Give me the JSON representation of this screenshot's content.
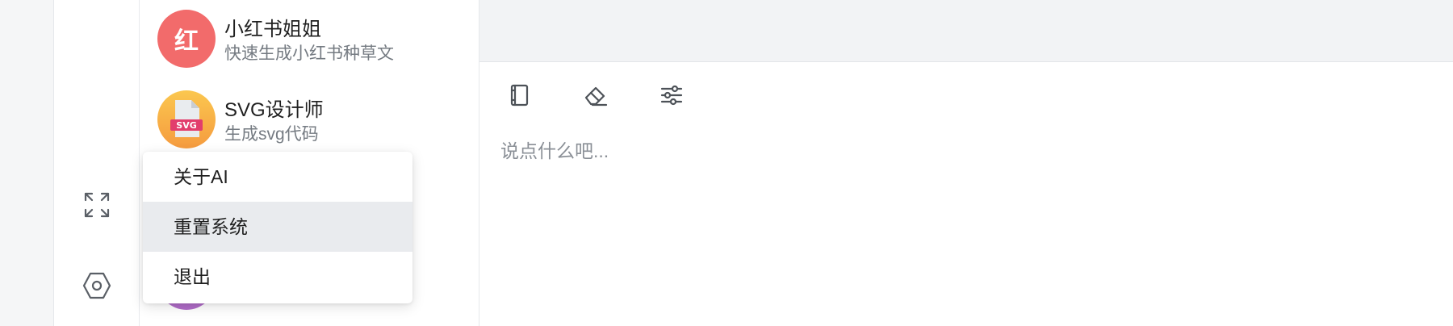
{
  "sidebar_icons": {
    "expand": "expand-arrows-icon",
    "settings": "hexagon-settings-icon"
  },
  "assistants": [
    {
      "avatar_text": "红",
      "avatar_color": "#f26b6b",
      "title": "小红书姐姐",
      "subtitle": "快速生成小红书种草文"
    },
    {
      "avatar_text": "SVG",
      "avatar_color": "#f9b349",
      "title": "SVG设计师",
      "subtitle": "生成svg代码"
    }
  ],
  "toolbar": {
    "icons": [
      "book-icon",
      "eraser-icon",
      "sliders-icon"
    ]
  },
  "composer": {
    "placeholder": "说点什么吧..."
  },
  "menu": {
    "items": [
      "关于AI",
      "重置系统",
      "退出"
    ],
    "active_index": 1
  },
  "colors": {
    "top_bar": "#f2f3f5",
    "menu_highlight": "#e9ebee",
    "placeholder": "#8a8f96"
  }
}
